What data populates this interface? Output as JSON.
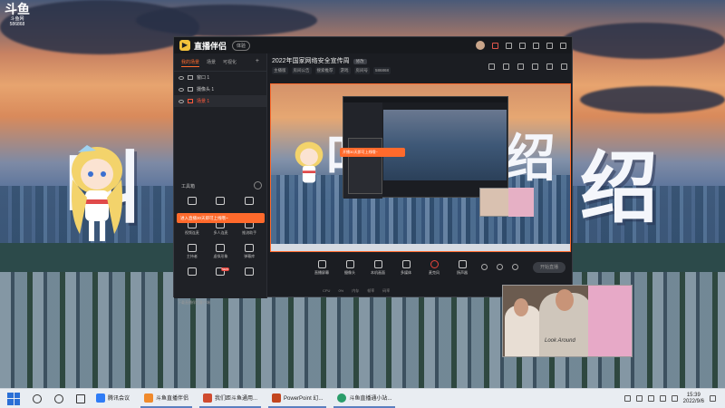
{
  "desktop": {
    "logo_mark": "斗鱼",
    "logo_sub": "斗鱼网",
    "logo_id": "586868",
    "big_text": [
      "叫",
      "绍"
    ]
  },
  "app": {
    "name": "直播伴侣",
    "version_badge": "体验",
    "room_title": "2022年国家网络安全宣传周",
    "room_badge": "修改",
    "room_meta": [
      "主播版",
      "房间公告",
      "搜索推荐",
      "游戏",
      "房间号",
      "586868"
    ],
    "tabs": [
      "我的场景",
      "场景",
      "可视化"
    ],
    "tab_add": "+",
    "sources": [
      {
        "label": "窗口 1",
        "active": false
      },
      {
        "label": "摄像头 1",
        "active": false
      },
      {
        "label": "场景 1",
        "active": true
      }
    ],
    "toolbox_title": "工具箱",
    "orange_tip": "进入直播30天即可上线哦~",
    "tools": [
      {
        "label": "",
        "new": false
      },
      {
        "label": "",
        "new": false
      },
      {
        "label": "",
        "new": false
      },
      {
        "label": "视频连麦",
        "new": false
      },
      {
        "label": "多人连麦",
        "new": false
      },
      {
        "label": "推流助手",
        "new": false
      },
      {
        "label": "主持者",
        "new": false
      },
      {
        "label": "虚拟形象",
        "new": false
      },
      {
        "label": "弹幕库",
        "new": false
      },
      {
        "label": "",
        "new": false
      },
      {
        "label": "",
        "new": true
      },
      {
        "label": "",
        "new": false
      }
    ],
    "bottom_tip": "下载直播伴侣客户端",
    "nested_tip": "开播30天即可上线哦~",
    "controls": [
      {
        "label": "直播屏幕",
        "icon": "screen-icon"
      },
      {
        "label": "摄像头",
        "icon": "camera-icon"
      },
      {
        "label": "本机画面",
        "icon": "window-icon"
      },
      {
        "label": "多媒体",
        "icon": "media-icon"
      },
      {
        "label": "麦克风",
        "icon": "mic-icon"
      },
      {
        "label": "扬声器",
        "icon": "speaker-icon"
      }
    ],
    "go_live": "开始直播",
    "status": [
      "CPU",
      "0%",
      "内存",
      "帧率",
      "码率"
    ]
  },
  "webcam": {
    "shirt_text": "Look Around"
  },
  "taskbar": {
    "apps": [
      {
        "label": "腾讯会议",
        "color": "#2f7cf6",
        "open": false
      },
      {
        "label": "斗鱼直播伴侣",
        "color": "#f08a2c",
        "open": true
      },
      {
        "label": "我们距斗鱼通用...",
        "color": "#d04b2f",
        "open": true
      },
      {
        "label": "PowerPoint 幻...",
        "color": "#c3461f",
        "open": true
      },
      {
        "label": "斗鱼直播通小站...",
        "color": "#2a9d6a",
        "open": true
      }
    ],
    "time": "15:39",
    "date": "2022/9/6"
  }
}
